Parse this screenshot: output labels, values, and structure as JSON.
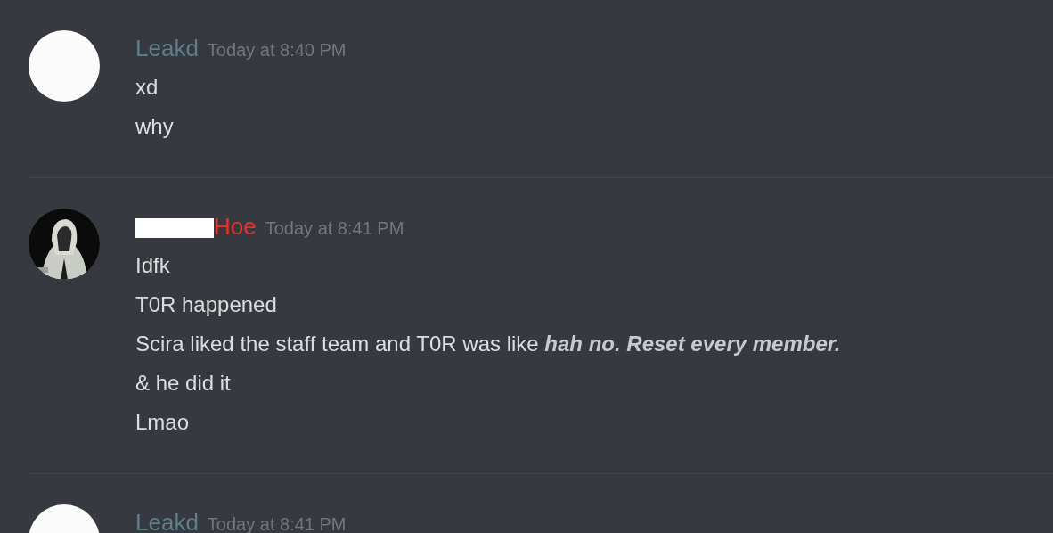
{
  "messages": [
    {
      "author": "Leakd",
      "color": "#5e7f8a",
      "redacted": false,
      "avatar": {
        "kind": "plain"
      },
      "time": "Today at 8:40 PM",
      "lines": [
        "xd",
        "why"
      ]
    },
    {
      "author": "Hoe",
      "color": "#e0352b",
      "redacted": true,
      "time": "Today at 8:41 PM",
      "lines": [
        "Idfk",
        "T0R happened",
        "Scira liked the staff team and T0R was like **hah no. Reset every member.**",
        "& he did it",
        "Lmao"
      ]
    },
    {
      "author": "Leakd",
      "color": "#5e7f8a",
      "redacted": false,
      "avatar": {
        "kind": "plain"
      },
      "time": "Today at 8:41 PM"
    }
  ]
}
